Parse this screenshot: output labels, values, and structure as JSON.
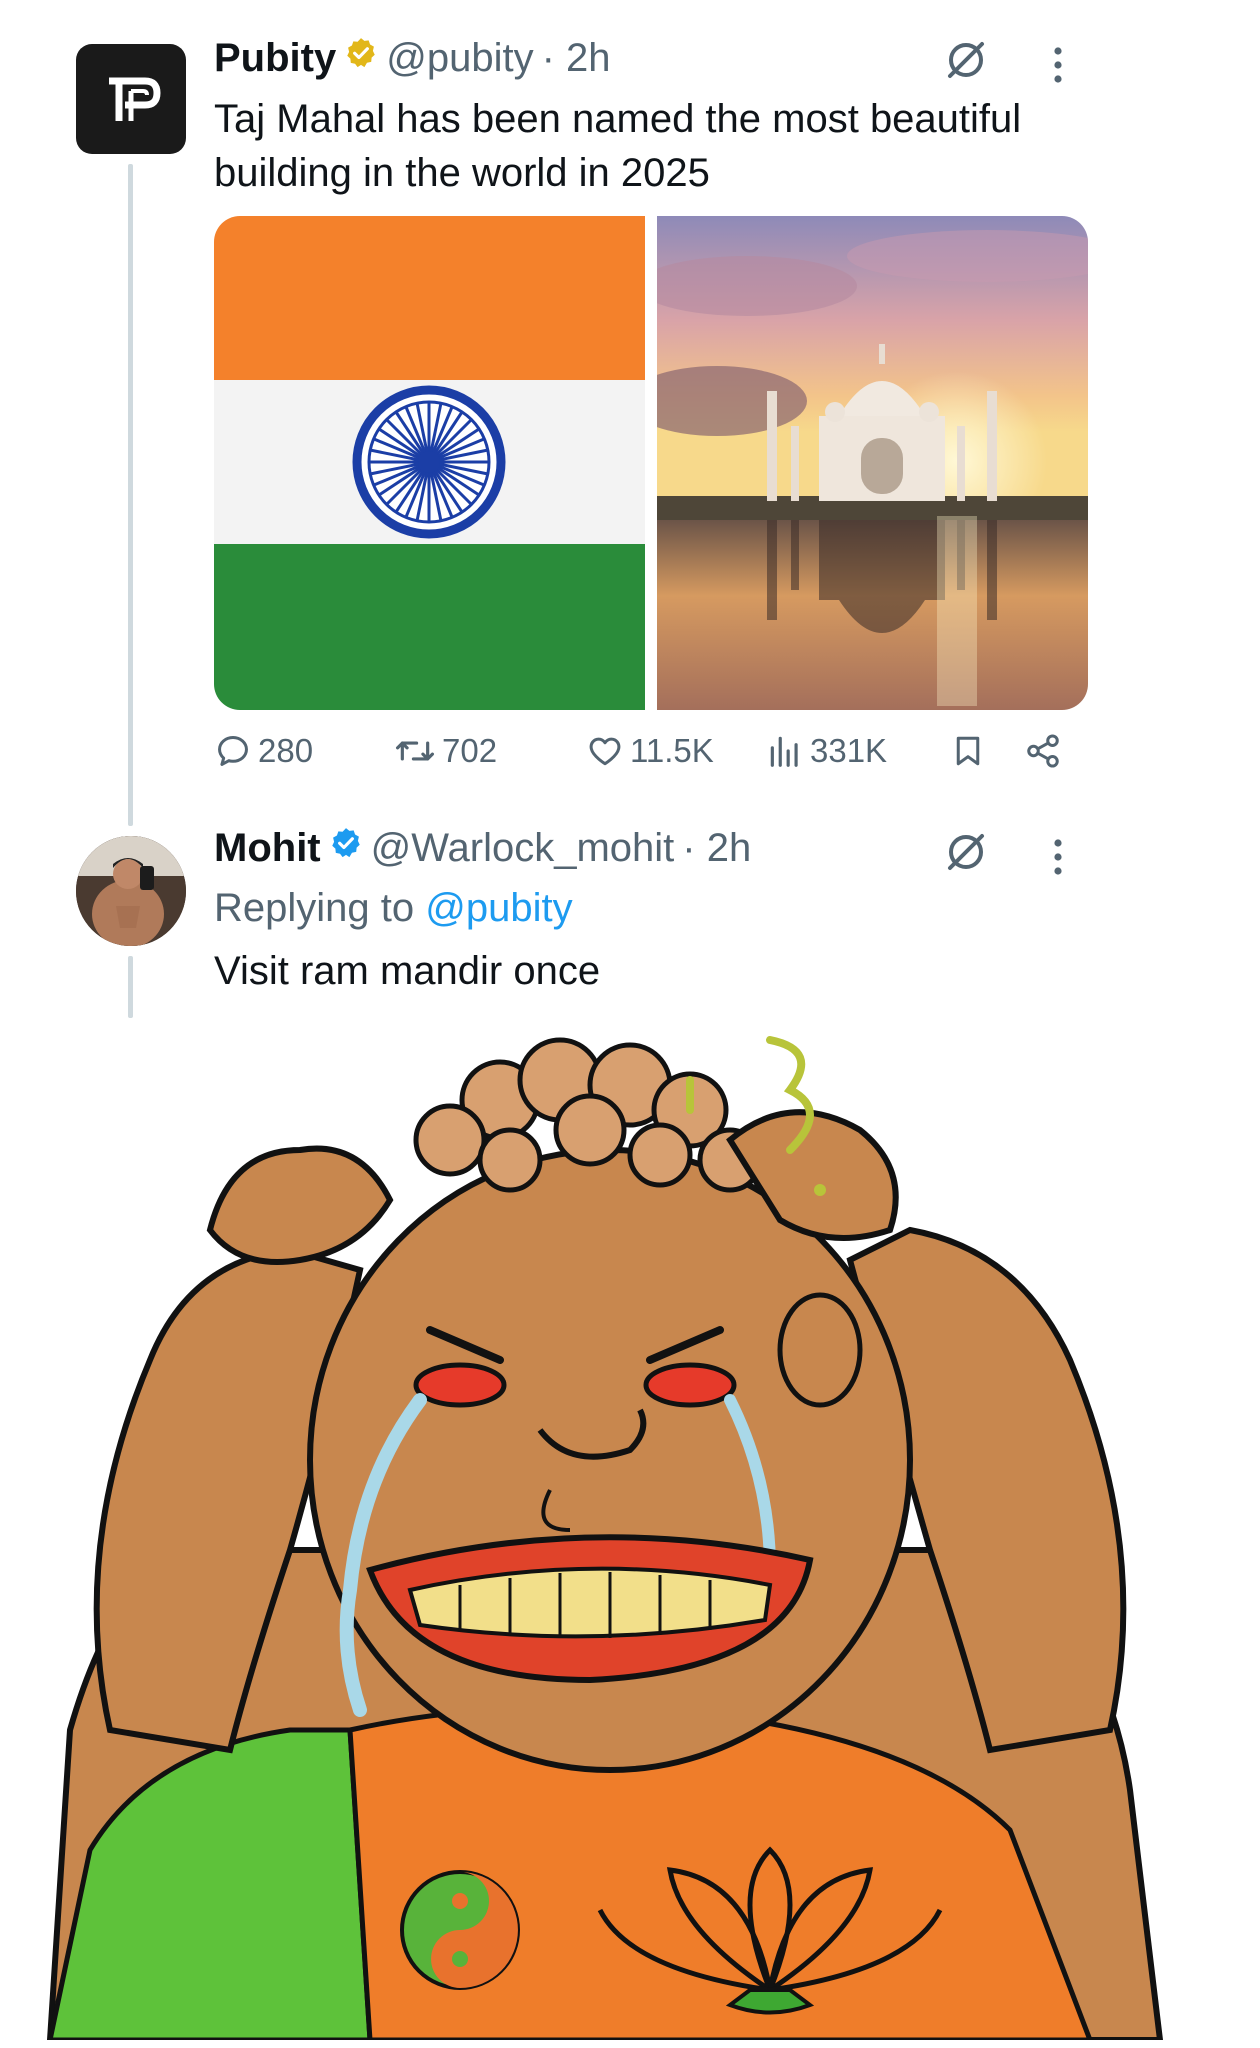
{
  "tweet": {
    "author_name": "Pubity",
    "author_handle": "@pubity",
    "time": "· 2h",
    "text": "Taj Mahal has been named the most beautiful building in the world in 2025",
    "media": [
      {
        "icon": "india-flag-image"
      },
      {
        "icon": "taj-mahal-sunset-photo"
      }
    ],
    "stats": {
      "replies": "280",
      "retweets": "702",
      "likes": "11.5K",
      "views": "331K"
    }
  },
  "reply": {
    "author_name": "Mohit",
    "author_handle": "@Warlock_mohit",
    "time": "· 2h",
    "replying_prefix": "Replying to ",
    "replying_mention": "@pubity",
    "text": "Visit ram mandir once",
    "attachment": {
      "icon": "crying-cartoon-meme-image"
    }
  },
  "colors": {
    "accent": "#1d9bf0",
    "verified_gold": "#e2b719",
    "verified_blue": "#1d9bf0",
    "muted_text": "#536471",
    "flag_saffron": "#f4812b",
    "flag_green": "#2a8c3a",
    "chakra_blue": "#1b3ea6"
  }
}
